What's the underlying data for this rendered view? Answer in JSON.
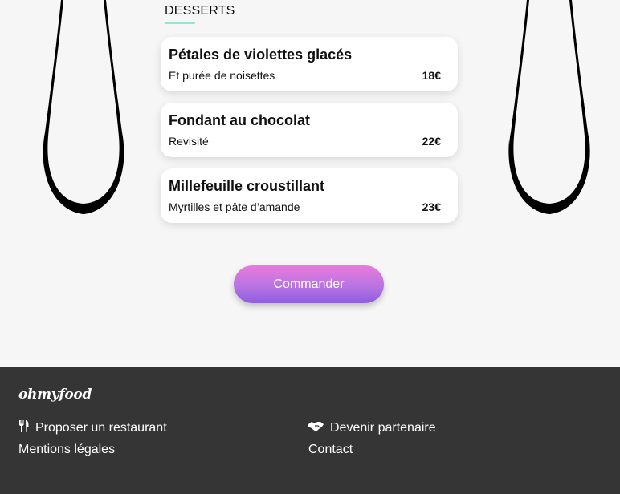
{
  "menu": {
    "section_title": "DESSERTS",
    "dishes": [
      {
        "name": "Pétales de violettes glacés",
        "description": "Et purée de noisettes",
        "price": "18€"
      },
      {
        "name": "Fondant au chocolat",
        "description": "Revisité",
        "price": "22€"
      },
      {
        "name": "Millefeuille croustillant",
        "description": "Myrtilles et pâte d’amande",
        "price": "23€"
      }
    ]
  },
  "actions": {
    "order_label": "Commander"
  },
  "footer": {
    "logo": "ohmyfood",
    "links": {
      "propose_restaurant": {
        "label": "Proposer un restaurant",
        "icon": "utensils-icon"
      },
      "legal": {
        "label": "Mentions légales"
      },
      "partner": {
        "label": "Devenir partenaire",
        "icon": "handshake-icon"
      },
      "contact": {
        "label": "Contact"
      }
    }
  },
  "colors": {
    "accent_underline": "#99e2d0",
    "button_gradient_top": "#e97bdc",
    "button_gradient_bottom": "#8e5de0",
    "footer_background": "#353535",
    "page_background": "#f6f6f6"
  }
}
